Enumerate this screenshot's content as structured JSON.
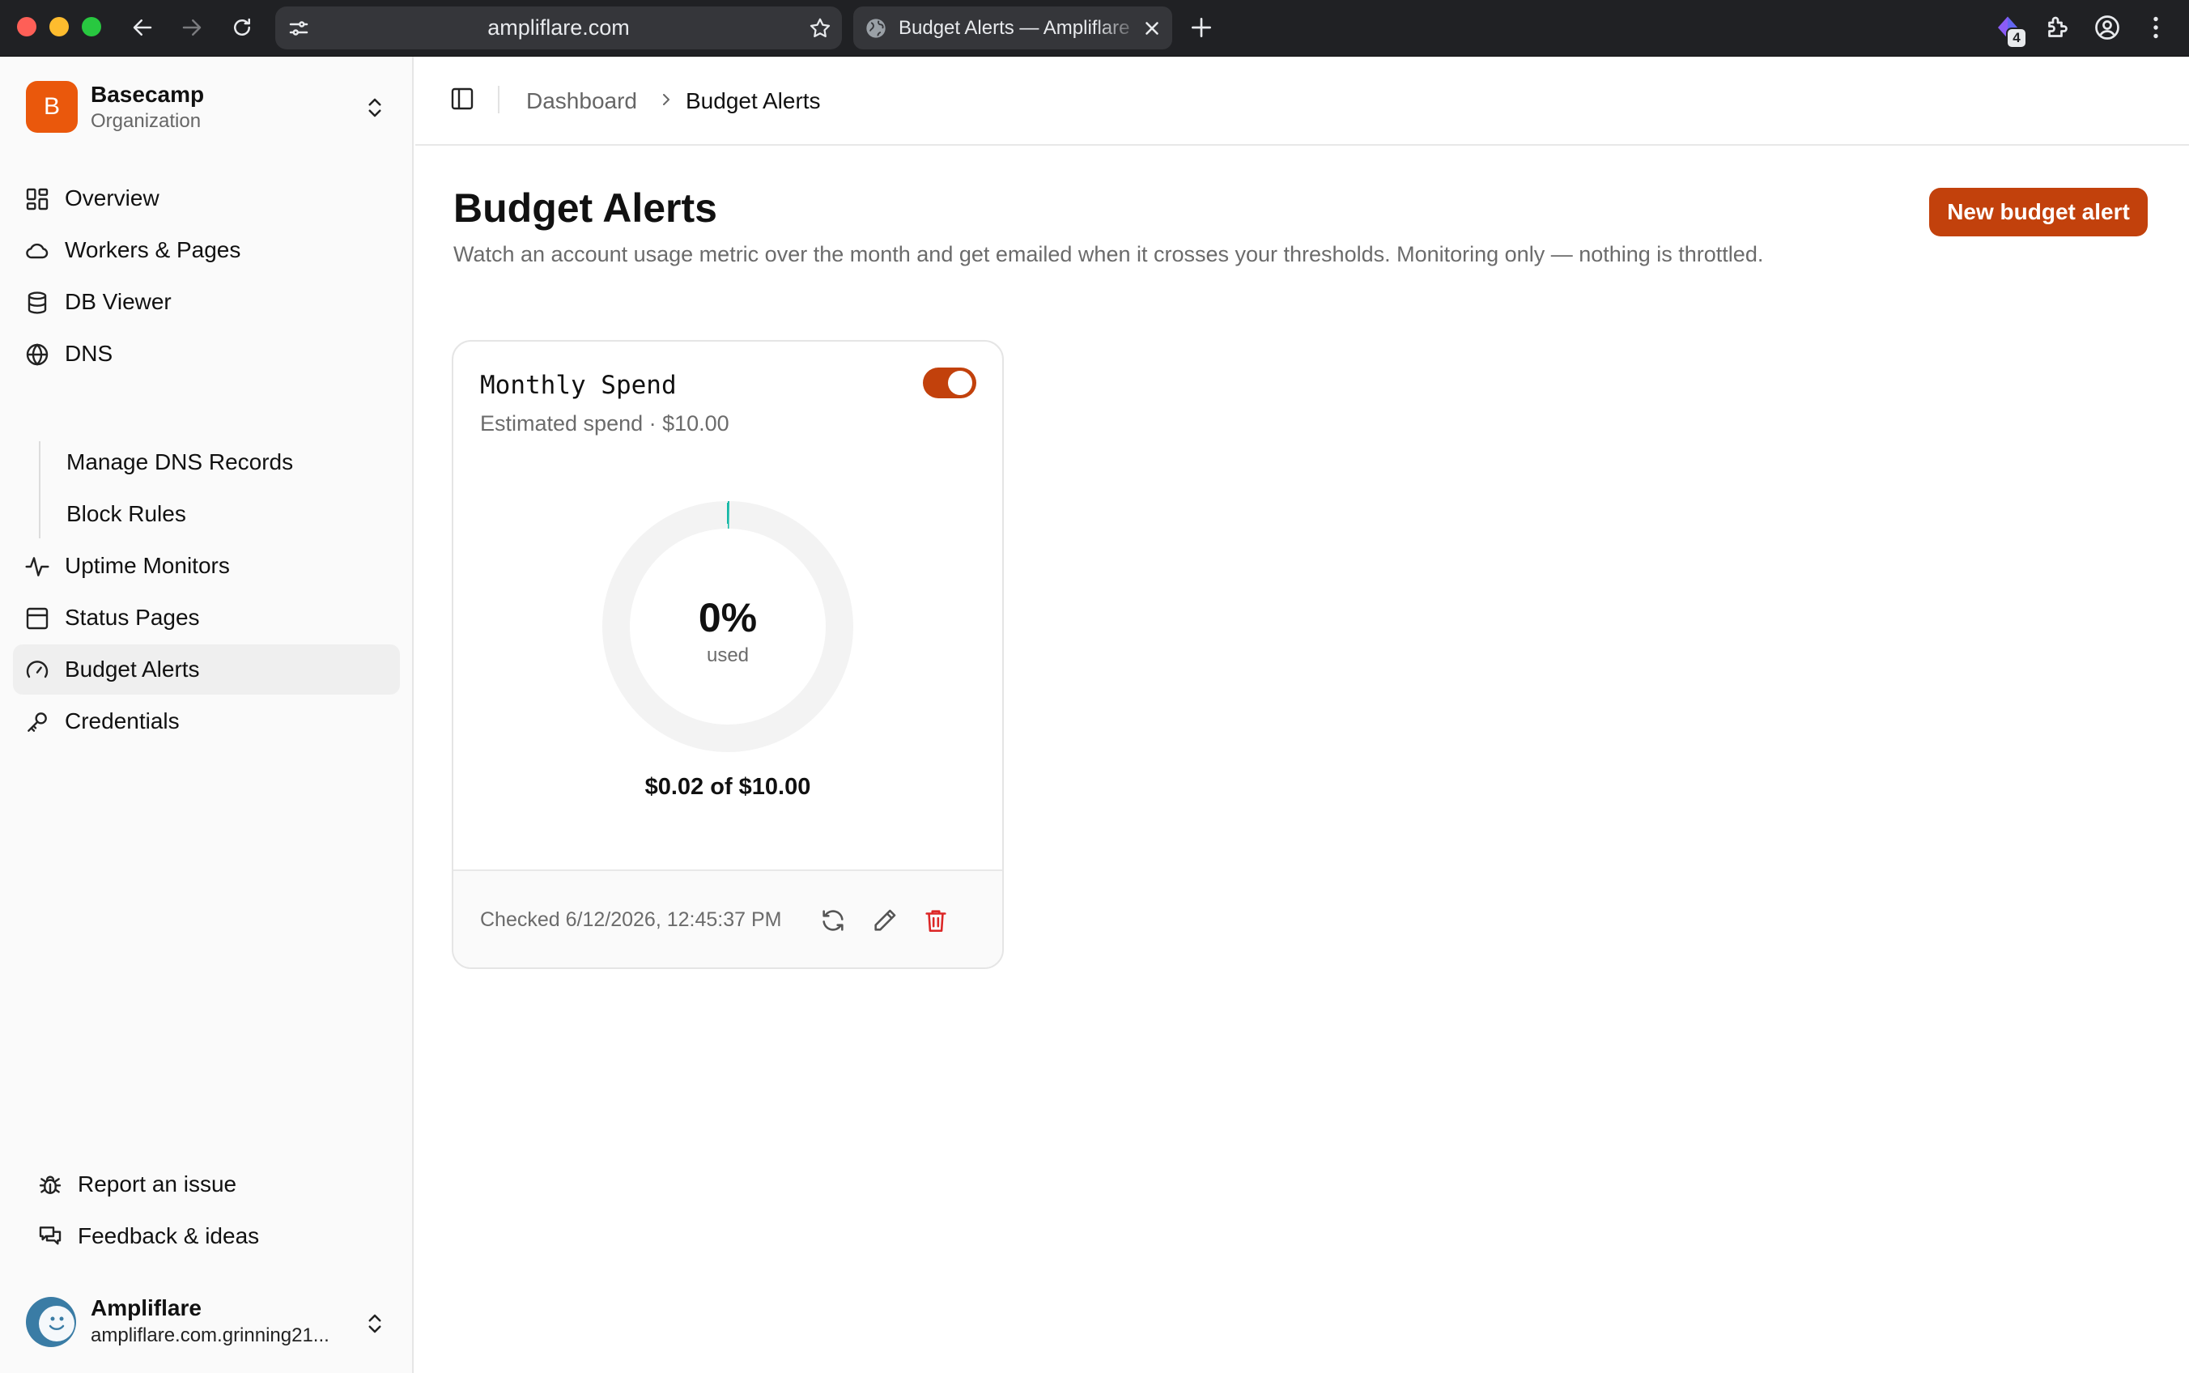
{
  "browser": {
    "url": "ampliflare.com",
    "tab_title": "Budget Alerts — Ampliflare",
    "extension_badge": "4"
  },
  "sidebar": {
    "org_initial": "B",
    "org_name": "Basecamp",
    "org_type": "Organization",
    "items": [
      {
        "label": "Overview",
        "icon": "grid-icon"
      },
      {
        "label": "Workers & Pages",
        "icon": "cloud-icon"
      },
      {
        "label": "DB Viewer",
        "icon": "database-icon"
      },
      {
        "label": "DNS",
        "icon": "globe-icon"
      },
      {
        "label": "Uptime Monitors",
        "icon": "activity-icon"
      },
      {
        "label": "Status Pages",
        "icon": "browser-window-icon"
      },
      {
        "label": "Budget Alerts",
        "icon": "gauge-icon"
      },
      {
        "label": "Credentials",
        "icon": "key-icon"
      }
    ],
    "dns_subitems": [
      "Manage DNS Records",
      "Block Rules"
    ],
    "footer_items": [
      {
        "label": "Report an issue",
        "icon": "bug-icon"
      },
      {
        "label": "Feedback & ideas",
        "icon": "chat-bubbles-icon"
      }
    ],
    "user_name": "Ampliflare",
    "user_email": "ampliflare.com.grinning21..."
  },
  "breadcrumb": {
    "parent": "Dashboard",
    "current": "Budget Alerts"
  },
  "page": {
    "title": "Budget Alerts",
    "description": "Watch an account usage metric over the month and get emailed when it crosses your thresholds. Monitoring only — nothing is throttled.",
    "new_button": "New budget alert"
  },
  "alert_card": {
    "name": "Monthly Spend",
    "subtitle": "Estimated spend · $10.00",
    "enabled": true,
    "percent_label": "0%",
    "used_label": "used",
    "used_fraction": 0.002,
    "amount_text": "$0.02 of $10.00",
    "checked_text": "Checked 6/12/2026, 12:45:37 PM"
  },
  "colors": {
    "accent": "#c2410c",
    "org_avatar": "#ea580c",
    "danger": "#dc2626",
    "gauge_track": "#f3f3f3",
    "gauge_fill": "#14b8a6"
  }
}
